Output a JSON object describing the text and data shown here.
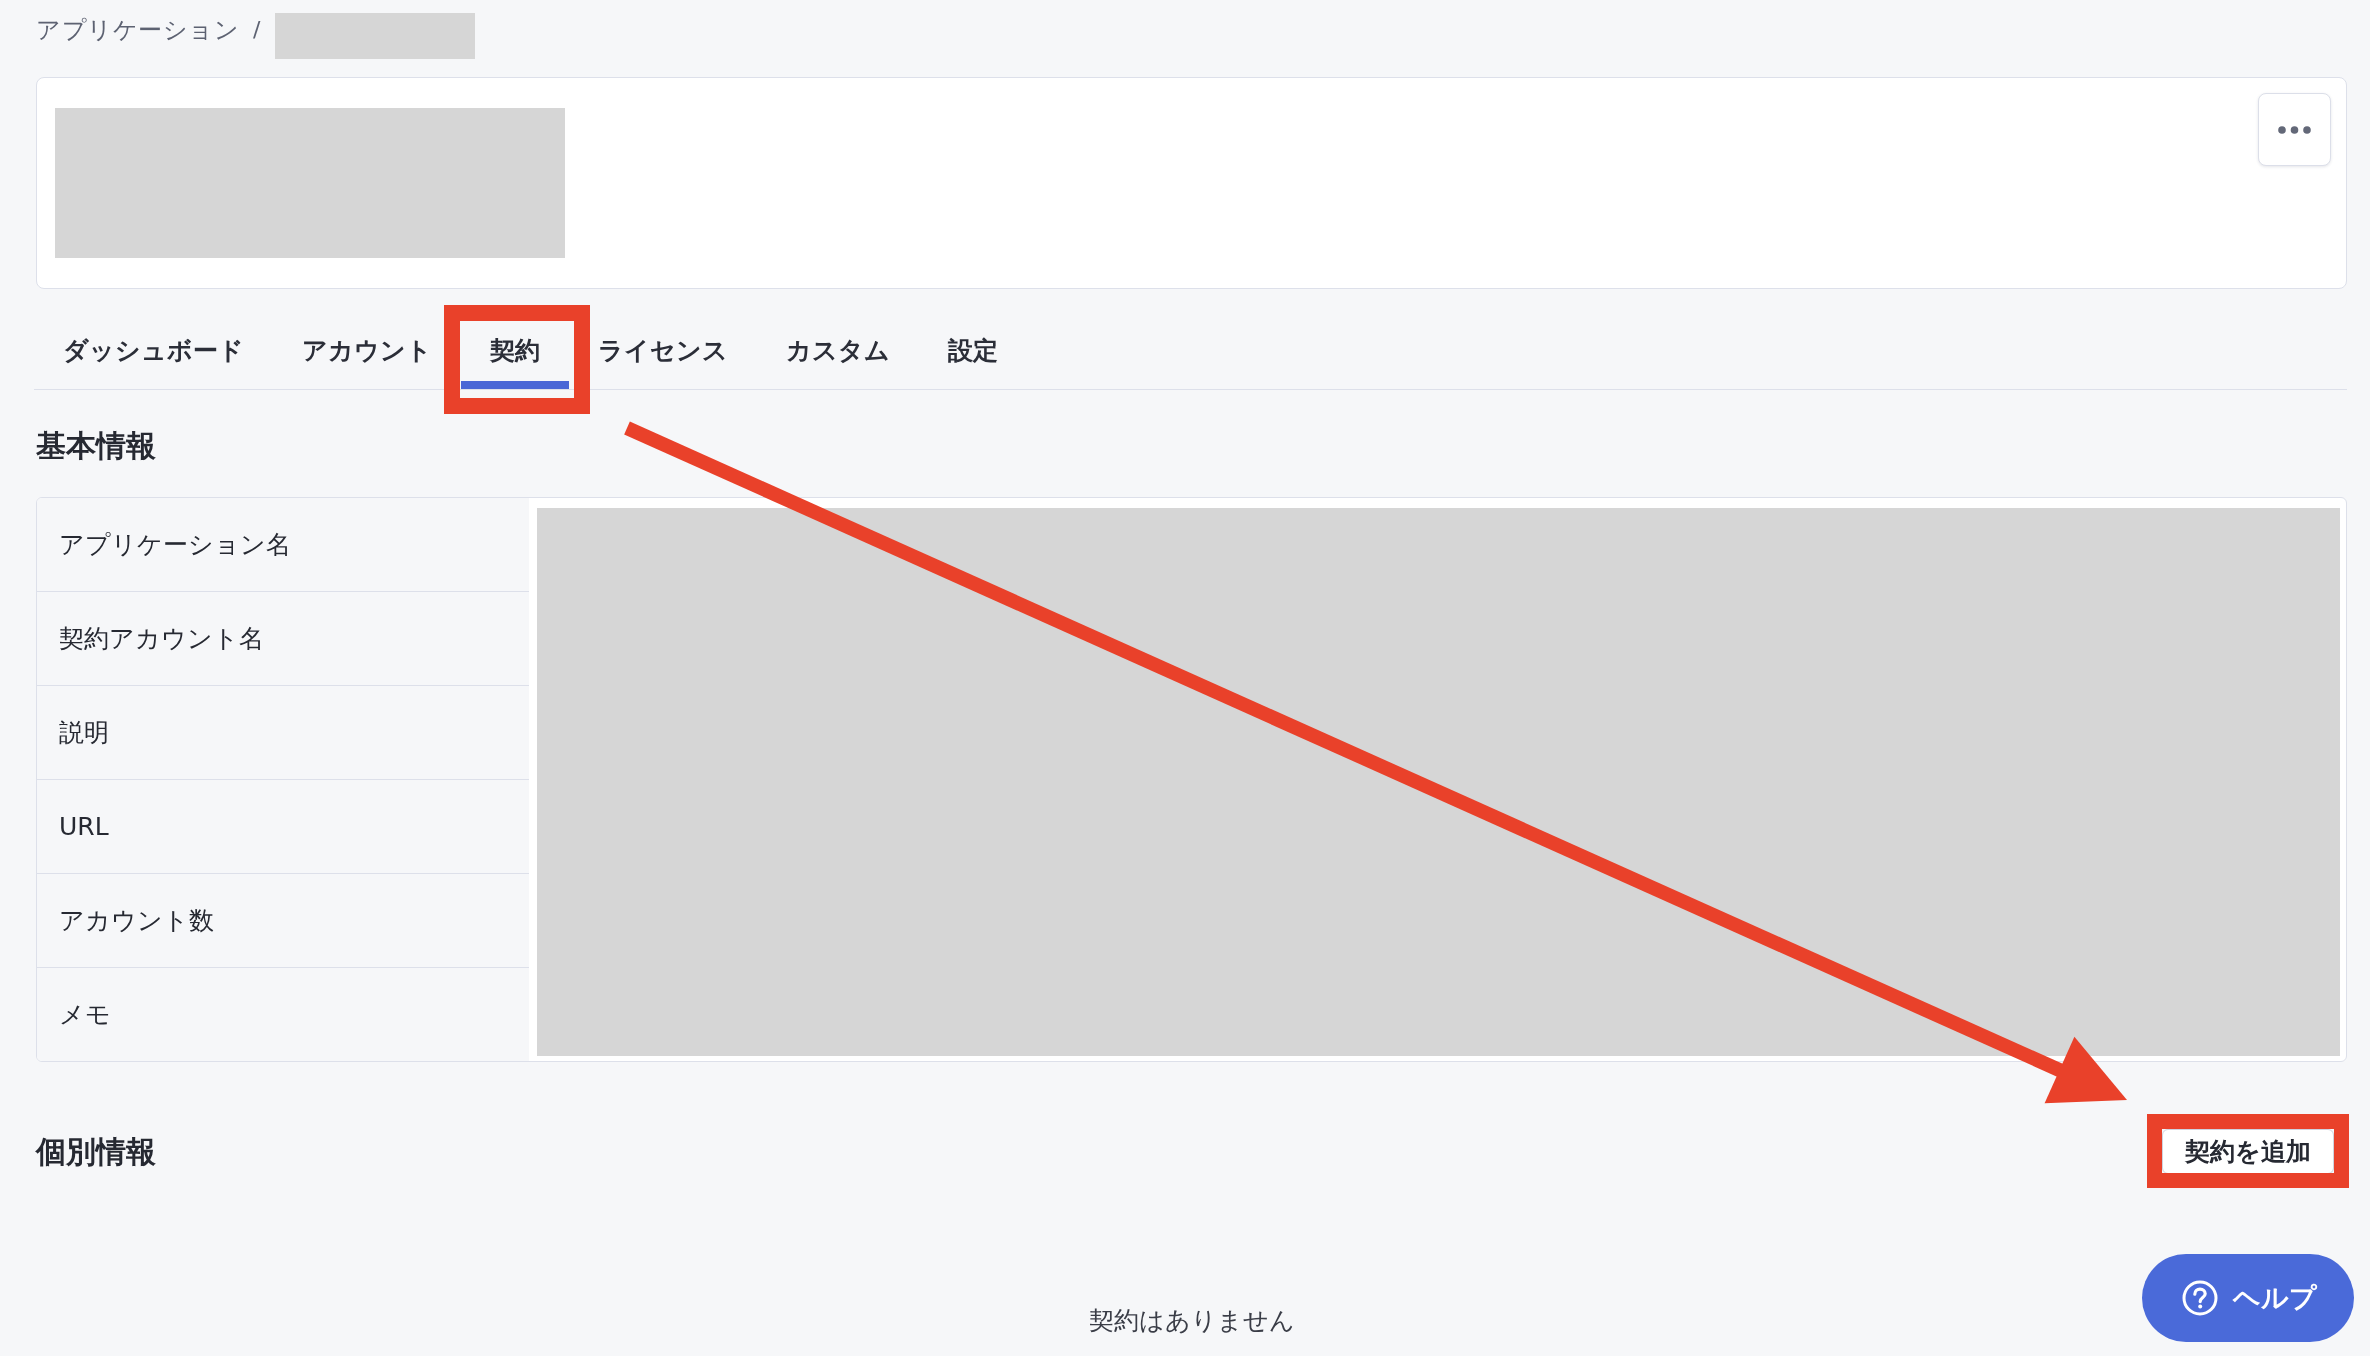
{
  "breadcrumb": [
    {
      "kind": "link",
      "label": "アプリケーション"
    },
    {
      "kind": "separator",
      "label": "/"
    },
    {
      "kind": "redacted"
    }
  ],
  "tabs": [
    {
      "label": "ダッシュボード",
      "selected": false,
      "highlighted": false
    },
    {
      "label": "アカウント",
      "selected": false,
      "highlighted": false
    },
    {
      "label": "契約",
      "selected": true,
      "highlighted": true
    },
    {
      "label": "ライセンス",
      "selected": false,
      "highlighted": false
    },
    {
      "label": "カスタム",
      "selected": false,
      "highlighted": false
    },
    {
      "label": "設定",
      "selected": false,
      "highlighted": false
    }
  ],
  "basic_info": {
    "heading": "基本情報",
    "rows": [
      {
        "label": "アプリケーション名"
      },
      {
        "label": "契約アカウント名"
      },
      {
        "label": "説明"
      },
      {
        "label": "URL"
      },
      {
        "label": "アカウント数"
      },
      {
        "label": "メモ"
      }
    ]
  },
  "individual_info": {
    "heading": "個別情報",
    "add_button": {
      "label": "契約を追加",
      "highlighted": true
    },
    "empty_message": "契約はありません"
  },
  "help_button": {
    "label": "ヘルプ"
  }
}
